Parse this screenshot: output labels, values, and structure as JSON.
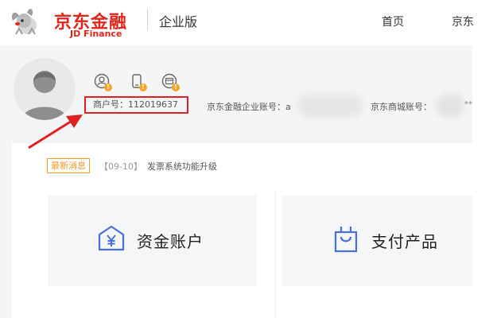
{
  "header": {
    "logo_cn": "京东金融",
    "logo_en": "JD Finance",
    "edition": "企业版",
    "nav": [
      "首页",
      "京东"
    ]
  },
  "profile": {
    "merchant_no_label": "商户号：",
    "merchant_no_value": "112019637",
    "finance_account_label": "京东金融企业账号：",
    "finance_account_value": "a",
    "mall_account_label": "京东商城账号：",
    "mall_account_value": "**"
  },
  "news": {
    "tag": "最新消息",
    "date": "【09-10】",
    "text": "发票系统功能升级"
  },
  "cards": {
    "fund_account": "资金账户",
    "pay_products": "支付产品"
  },
  "colors": {
    "brand_red": "#e1251b",
    "highlight_red": "#e02020",
    "news_orange": "#f59a23",
    "icon_blue": "#4a6fd8"
  }
}
